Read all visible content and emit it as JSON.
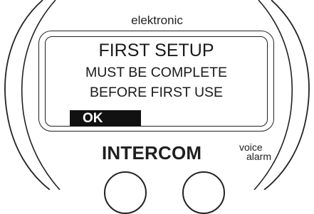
{
  "device": {
    "brand_top": "elektronic",
    "brand_name": "INTERCOM",
    "brand_sub_line1": "voice",
    "brand_sub_line2": "alarm"
  },
  "screen": {
    "title": "FIRST SETUP",
    "message_line1": "MUST BE COMPLETE",
    "message_line2": "BEFORE FIRST USE",
    "ok_label": "OK"
  },
  "colors": {
    "outline": "#222222",
    "ok_button_bg": "#111111",
    "ok_button_text": "#ffffff",
    "background": "#ffffff"
  }
}
